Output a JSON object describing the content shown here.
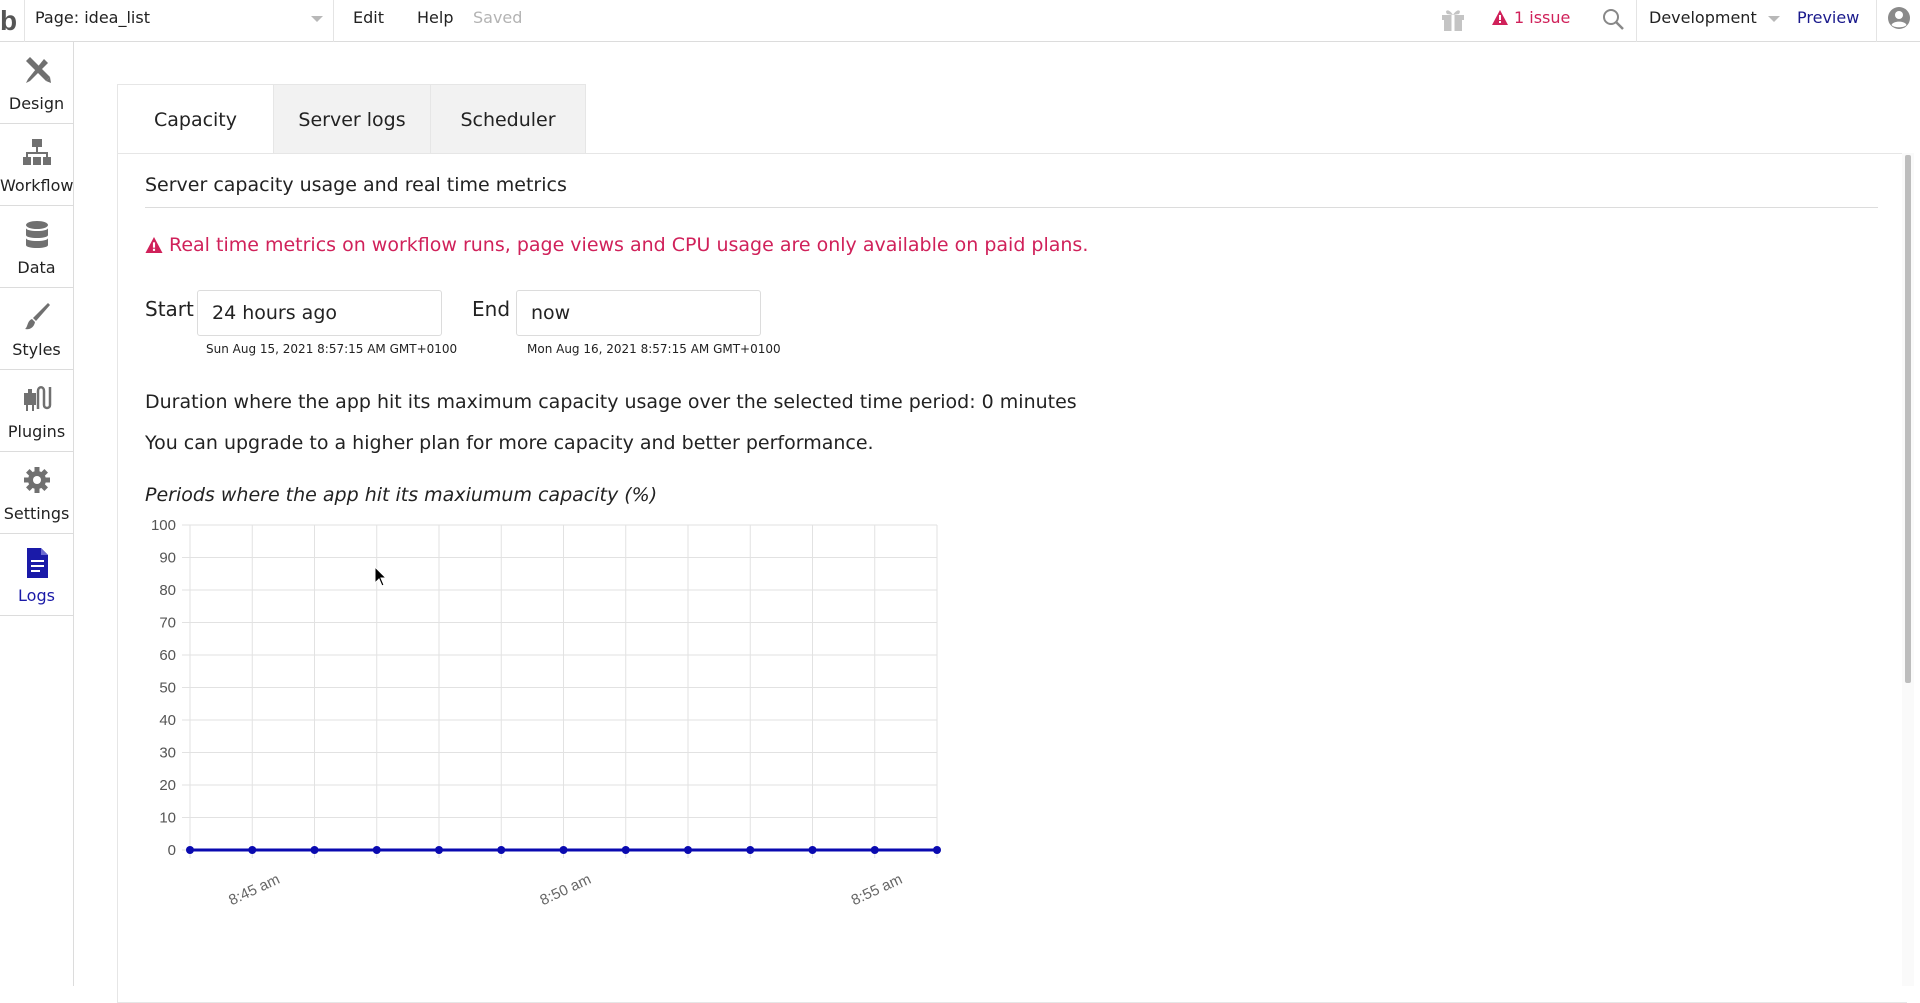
{
  "topbar": {
    "logo": "b",
    "page_select": "Page: idea_list",
    "menu": [
      "Edit",
      "Help"
    ],
    "save_status": "Saved",
    "issues_label": "1 issue",
    "environment": "Development",
    "preview_label": "Preview",
    "colors": {
      "issue": "#d0215a",
      "preview": "#1a1a8c"
    }
  },
  "sidebar": {
    "items": [
      {
        "label": "Design",
        "icon": "design-icon",
        "active": false
      },
      {
        "label": "Workflow",
        "icon": "workflow-icon",
        "active": false
      },
      {
        "label": "Data",
        "icon": "database-icon",
        "active": false
      },
      {
        "label": "Styles",
        "icon": "brush-icon",
        "active": false
      },
      {
        "label": "Plugins",
        "icon": "plugin-icon",
        "active": false
      },
      {
        "label": "Settings",
        "icon": "gear-icon",
        "active": false
      },
      {
        "label": "Logs",
        "icon": "document-icon",
        "active": true
      }
    ],
    "active_color": "#1a1aa8"
  },
  "tabs": [
    {
      "label": "Capacity",
      "active": true
    },
    {
      "label": "Server logs",
      "active": false
    },
    {
      "label": "Scheduler",
      "active": false
    }
  ],
  "capacity": {
    "subtitle": "Server capacity usage and real time metrics",
    "warning": "Real time metrics on workflow runs, page views and CPU usage are only available on paid plans.",
    "start_label": "Start",
    "start_value": "24 hours ago",
    "start_resolved": "Sun Aug 15, 2021 8:57:15 AM GMT+0100",
    "end_label": "End",
    "end_value": "now",
    "end_resolved": "Mon Aug 16, 2021 8:57:15 AM GMT+0100",
    "duration_text": "Duration where the app hit its maximum capacity usage over the selected time period: 0 minutes",
    "upgrade_text": "You can upgrade to a higher plan for more capacity and better performance.",
    "chart_title": "Periods where the app hit its maxiumum capacity (%)"
  },
  "chart_data": {
    "type": "line",
    "title": "Periods where the app hit its maxiumum capacity (%)",
    "xlabel": "",
    "ylabel": "",
    "x": [
      "8:44 am",
      "8:45 am",
      "8:46 am",
      "8:47 am",
      "8:48 am",
      "8:49 am",
      "8:50 am",
      "8:51 am",
      "8:52 am",
      "8:53 am",
      "8:54 am",
      "8:55 am",
      "8:56 am"
    ],
    "x_tick_labels": [
      "8:45 am",
      "8:50 am",
      "8:55 am"
    ],
    "series": [
      {
        "name": "capacity",
        "values": [
          0,
          0,
          0,
          0,
          0,
          0,
          0,
          0,
          0,
          0,
          0,
          0,
          0
        ],
        "color": "#0a0ab0"
      }
    ],
    "y_ticks": [
      0,
      10,
      20,
      30,
      40,
      50,
      60,
      70,
      80,
      90,
      100
    ],
    "ylim": [
      0,
      100
    ],
    "grid": true,
    "legend": "none"
  }
}
